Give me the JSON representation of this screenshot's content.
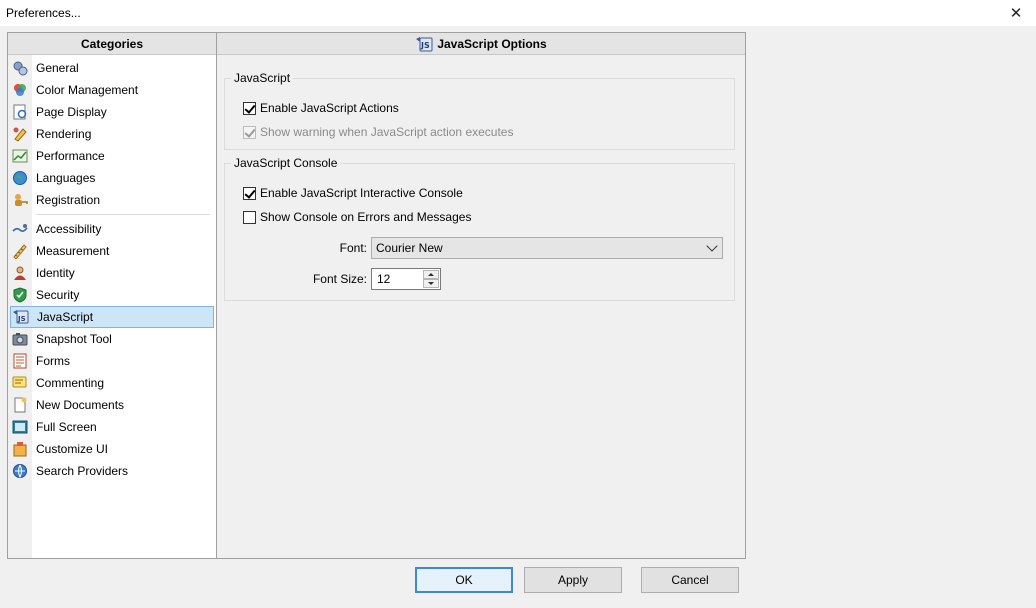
{
  "window": {
    "title": "Preferences..."
  },
  "categories": {
    "header": "Categories",
    "group1": [
      {
        "label": "General",
        "icon": "general-gears-icon"
      },
      {
        "label": "Color Management",
        "icon": "color-management-icon"
      },
      {
        "label": "Page Display",
        "icon": "page-display-icon"
      },
      {
        "label": "Rendering",
        "icon": "rendering-icon"
      },
      {
        "label": "Performance",
        "icon": "performance-chart-icon"
      },
      {
        "label": "Languages",
        "icon": "globe-icon"
      },
      {
        "label": "Registration",
        "icon": "registration-key-icon"
      }
    ],
    "group2": [
      {
        "label": "Accessibility",
        "icon": "accessibility-icon"
      },
      {
        "label": "Measurement",
        "icon": "measurement-ruler-icon"
      },
      {
        "label": "Identity",
        "icon": "identity-person-icon"
      },
      {
        "label": "Security",
        "icon": "security-shield-icon"
      },
      {
        "label": "JavaScript",
        "icon": "javascript-icon",
        "selected": true
      },
      {
        "label": "Snapshot Tool",
        "icon": "camera-icon"
      },
      {
        "label": "Forms",
        "icon": "forms-icon"
      },
      {
        "label": "Commenting",
        "icon": "commenting-icon"
      },
      {
        "label": "New Documents",
        "icon": "new-document-icon"
      },
      {
        "label": "Full Screen",
        "icon": "full-screen-icon"
      },
      {
        "label": "Customize UI",
        "icon": "customize-ui-icon"
      },
      {
        "label": "Search Providers",
        "icon": "search-providers-icon"
      }
    ]
  },
  "options": {
    "header": "JavaScript Options",
    "javascript_group": {
      "title": "JavaScript",
      "enable_actions": {
        "label": "Enable JavaScript Actions",
        "checked": true
      },
      "show_warning": {
        "label": "Show warning when JavaScript action executes",
        "checked": true,
        "disabled": true
      }
    },
    "console_group": {
      "title": "JavaScript Console",
      "enable_console": {
        "label": "Enable JavaScript Interactive Console",
        "checked": true
      },
      "show_on_errors": {
        "label": "Show Console on Errors and Messages",
        "checked": false
      },
      "font_label": "Font:",
      "font_value": "Courier New",
      "font_size_label": "Font Size:",
      "font_size_value": "12"
    }
  },
  "buttons": {
    "ok": "OK",
    "apply": "Apply",
    "cancel": "Cancel"
  },
  "colors": {
    "selection_bg": "#cde6f7",
    "selection_border": "#7eb4ea",
    "default_button_border": "#3f87d6"
  }
}
